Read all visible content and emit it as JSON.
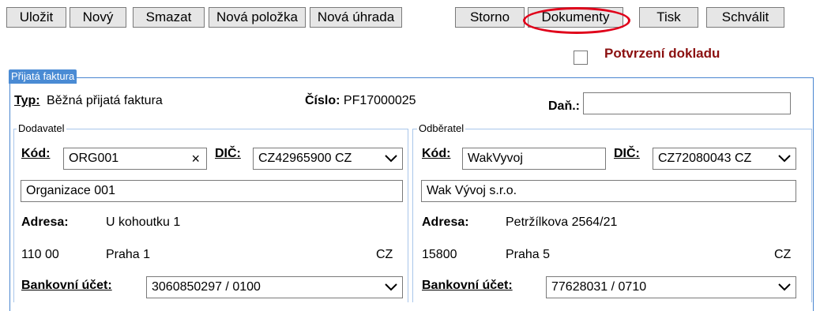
{
  "toolbar": {
    "buttons": [
      "Uložit",
      "Nový",
      "Smazat",
      "Nová položka",
      "Nová úhrada",
      "Storno",
      "Dokumenty",
      "Tisk",
      "Schválit"
    ]
  },
  "confirmation": {
    "label": "Potvrzení dokladu",
    "checked": false
  },
  "invoice": {
    "legend": "Přijatá faktura",
    "type_label": "Typ:",
    "type_value": "Běžná přijatá faktura",
    "number_label": "Číslo:",
    "number_value": "PF17000025",
    "tax_label": "Daň.:",
    "tax_value": ""
  },
  "supplier": {
    "legend": "Dodavatel",
    "code_label": "Kód:",
    "code_value": "ORG001",
    "clear_symbol": "×",
    "dic_label": "DIČ:",
    "dic_value": "CZ42965900 CZ",
    "name_value": "Organizace 001",
    "address_label": "Adresa:",
    "address_value": "U kohoutku 1",
    "zip": "110 00",
    "city": "Praha 1",
    "country": "CZ",
    "bank_label": "Bankovní účet:",
    "bank_value": "3060850297 / 0100"
  },
  "customer": {
    "legend": "Odběratel",
    "code_label": "Kód:",
    "code_value": "WakVyvoj",
    "dic_label": "DIČ:",
    "dic_value": "CZ72080043 CZ",
    "name_value": "Wak Vývoj s.r.o.",
    "address_label": "Adresa:",
    "address_value": "Petržílkova 2564/21",
    "zip": "15800",
    "city": "Praha 5",
    "country": "CZ",
    "bank_label": "Bankovní účet:",
    "bank_value": "77628031 / 0710"
  }
}
